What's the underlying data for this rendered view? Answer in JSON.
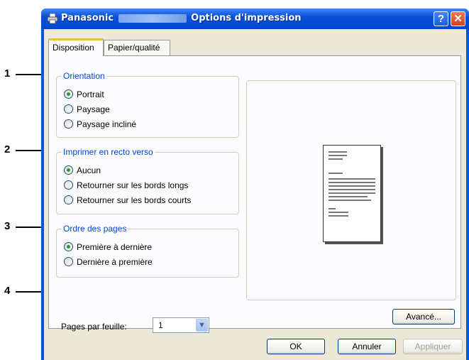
{
  "callouts": [
    "1",
    "2",
    "3",
    "4"
  ],
  "titlebar": {
    "brand": "Panasonic",
    "title_suffix": "Options d'impression",
    "help_label": "?",
    "close_label": "✕"
  },
  "tabs": [
    {
      "label": "Disposition",
      "active": true
    },
    {
      "label": "Papier/qualité",
      "active": false
    }
  ],
  "orientation": {
    "legend": "Orientation",
    "options": [
      {
        "label": "Portrait",
        "checked": true
      },
      {
        "label": "Paysage",
        "checked": false
      },
      {
        "label": "Paysage incliné",
        "checked": false
      }
    ]
  },
  "duplex": {
    "legend": "Imprimer en recto verso",
    "options": [
      {
        "label": "Aucun",
        "checked": true
      },
      {
        "label": "Retourner sur les bords longs",
        "checked": false
      },
      {
        "label": "Retourner sur les bords courts",
        "checked": false
      }
    ]
  },
  "page_order": {
    "legend": "Ordre des pages",
    "options": [
      {
        "label": "Première à dernière",
        "checked": true
      },
      {
        "label": "Dernière à première",
        "checked": false
      }
    ]
  },
  "pages_per_sheet": {
    "label": "Pages par feuille:",
    "value": "1"
  },
  "buttons": {
    "advanced": "Avancé...",
    "ok": "OK",
    "cancel": "Annuler",
    "apply": "Appliquer"
  },
  "colors": {
    "titlebar": "#0a54e4",
    "group_legend": "#0046d5",
    "radio_selected": "#21a121",
    "active_tab_accent": "#f5bd3c"
  }
}
